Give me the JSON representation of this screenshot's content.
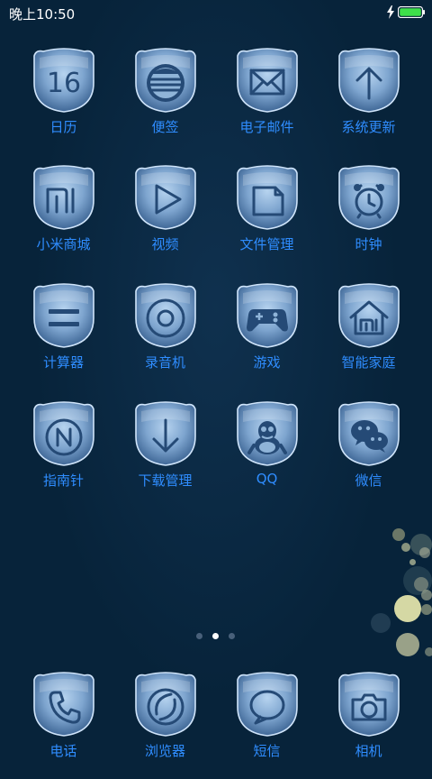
{
  "status_bar": {
    "time": "晚上10:50"
  },
  "apps": [
    {
      "label": "日历",
      "icon": "calendar-icon"
    },
    {
      "label": "便签",
      "icon": "notes-icon"
    },
    {
      "label": "电子邮件",
      "icon": "email-icon"
    },
    {
      "label": "系统更新",
      "icon": "update-icon"
    },
    {
      "label": "小米商城",
      "icon": "mi-store-icon"
    },
    {
      "label": "视频",
      "icon": "video-icon"
    },
    {
      "label": "文件管理",
      "icon": "folder-icon"
    },
    {
      "label": "时钟",
      "icon": "alarm-clock-icon"
    },
    {
      "label": "计算器",
      "icon": "calculator-icon"
    },
    {
      "label": "录音机",
      "icon": "recorder-icon"
    },
    {
      "label": "游戏",
      "icon": "gamepad-icon"
    },
    {
      "label": "智能家庭",
      "icon": "smart-home-icon"
    },
    {
      "label": "指南针",
      "icon": "compass-icon"
    },
    {
      "label": "下载管理",
      "icon": "download-icon"
    },
    {
      "label": "QQ",
      "icon": "qq-penguin-icon"
    },
    {
      "label": "微信",
      "icon": "wechat-icon"
    }
  ],
  "calendar_day": "16",
  "page_indicator": {
    "count": 3,
    "active_index": 1
  },
  "dock": [
    {
      "label": "电话",
      "icon": "phone-icon"
    },
    {
      "label": "浏览器",
      "icon": "browser-icon"
    },
    {
      "label": "短信",
      "icon": "message-icon"
    },
    {
      "label": "相机",
      "icon": "camera-icon"
    }
  ],
  "colors": {
    "background": "#07233a",
    "label": "#2f8dff",
    "battery": "#3ee04a",
    "icon_glass": "#6f9ccc"
  }
}
